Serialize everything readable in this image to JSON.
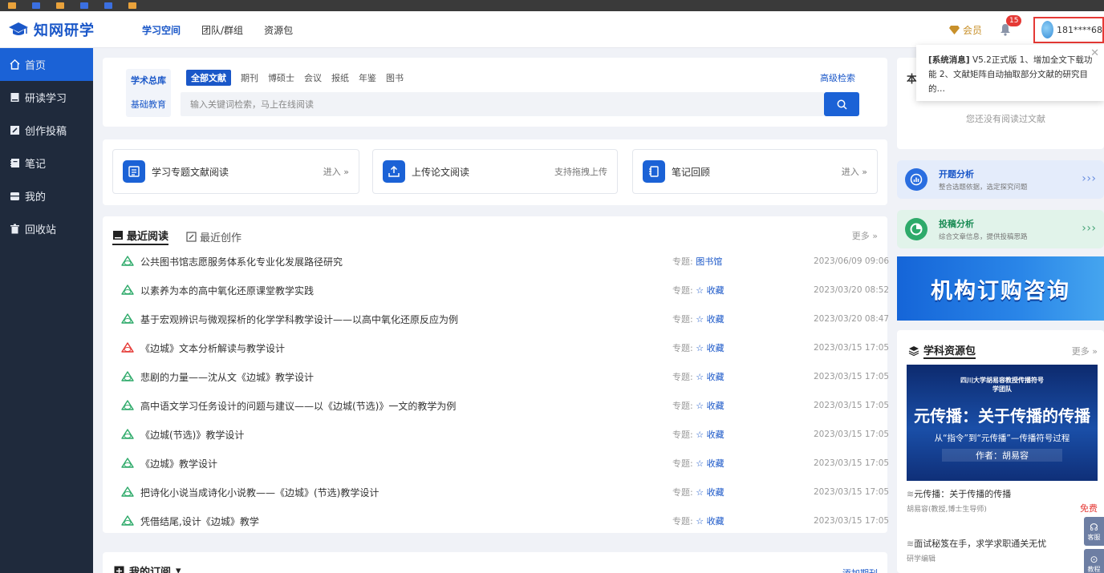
{
  "browser": {
    "bookmarks": [
      "",
      "",
      "",
      "",
      "",
      "",
      "",
      "",
      ""
    ]
  },
  "header": {
    "logo": "知网研学",
    "nav": [
      "学习空间",
      "团队/群组",
      "资源包"
    ],
    "vip": "会员",
    "notification_count": "15",
    "user": "181****68"
  },
  "sidebar": {
    "items": [
      "首页",
      "研读学习",
      "创作投稿",
      "笔记",
      "我的",
      "回收站"
    ]
  },
  "search": {
    "dbs": [
      "学术总库",
      "基础教育"
    ],
    "types": [
      "全部文献",
      "期刊",
      "博硕士",
      "会议",
      "报纸",
      "年鉴",
      "图书"
    ],
    "advanced": "高级检索",
    "placeholder": "输入关键词检索，马上在线阅读"
  },
  "quick": [
    {
      "label": "学习专题文献阅读",
      "action": "进入 »"
    },
    {
      "label": "上传论文阅读",
      "action": "支持拖拽上传"
    },
    {
      "label": "笔记回顾",
      "action": "进入 »"
    }
  ],
  "recent": {
    "tab_reading": "最近阅读",
    "tab_writing": "最近创作",
    "more": "更多 »",
    "topic_label": "专题:",
    "items": [
      {
        "title": "公共图书馆志愿服务体系化专业化发展路径研究",
        "topic": "图书馆",
        "date": "2023/06/09 09:06",
        "type": "caj"
      },
      {
        "title": "以素养为本的高中氧化还原课堂教学实践",
        "topic": "☆ 收藏",
        "date": "2023/03/20 08:52",
        "type": "caj"
      },
      {
        "title": "基于宏观辨识与微观探析的化学学科教学设计——以高中氧化还原反应为例",
        "topic": "☆ 收藏",
        "date": "2023/03/20 08:47",
        "type": "caj"
      },
      {
        "title": "《边城》文本分析解读与教学设计",
        "topic": "☆ 收藏",
        "date": "2023/03/15 17:05",
        "type": "pdf"
      },
      {
        "title": "悲剧的力量——沈从文《边城》教学设计",
        "topic": "☆ 收藏",
        "date": "2023/03/15 17:05",
        "type": "caj"
      },
      {
        "title": "高中语文学习任务设计的问题与建议——以《边城(节选)》一文的教学为例",
        "topic": "☆ 收藏",
        "date": "2023/03/15 17:05",
        "type": "caj"
      },
      {
        "title": "《边城(节选)》教学设计",
        "topic": "☆ 收藏",
        "date": "2023/03/15 17:05",
        "type": "caj"
      },
      {
        "title": "《边城》教学设计",
        "topic": "☆ 收藏",
        "date": "2023/03/15 17:05",
        "type": "caj"
      },
      {
        "title": "把诗化小说当成诗化小说教——《边城》(节选)教学设计",
        "topic": "☆ 收藏",
        "date": "2023/03/15 17:05",
        "type": "caj"
      },
      {
        "title": "凭借结尾,设计《边城》教学",
        "topic": "☆ 收藏",
        "date": "2023/03/15 17:05",
        "type": "caj"
      }
    ]
  },
  "subscription": {
    "title": "我的订阅",
    "add": "添加期刊"
  },
  "right": {
    "reading_title_char": "本",
    "no_reading": "您还没有阅读过文献",
    "notice_tag": "[系统消息]",
    "notice_text": " V5.2正式版 1、增加全文下载功能 2、文献矩阵自动抽取部分文献的研究目的…",
    "banners": [
      {
        "title": "开题分析",
        "desc": "整合选题依据，选定探究问题",
        "bg": "#e4ecfb",
        "icon_bg": "#2a6ee0"
      },
      {
        "title": "投稿分析",
        "desc": "综合文章信息，提供投稿思路",
        "bg": "#e1f3ea",
        "icon_bg": "#2eaa6a"
      }
    ],
    "promo": "机构订购咨询",
    "resource_title": "学科资源包",
    "resource_more": "更多 »",
    "res_banner": {
      "org": "四川大学胡易容教授传播符号学团队",
      "headline": "元传播：关于传播的传播",
      "sub": "从“指令”到“元传播”—传播符号过程",
      "author": "作者：胡易容"
    },
    "resources": [
      {
        "title": "元传播：关于传播的传播",
        "sub": "胡易容(教授,博士生导师)",
        "price": "免费"
      },
      {
        "title": "面试秘笈在手，求学求职通关无忧",
        "sub": "研学编辑",
        "price": ""
      }
    ],
    "float_service": "客服",
    "float_video": "教程"
  }
}
